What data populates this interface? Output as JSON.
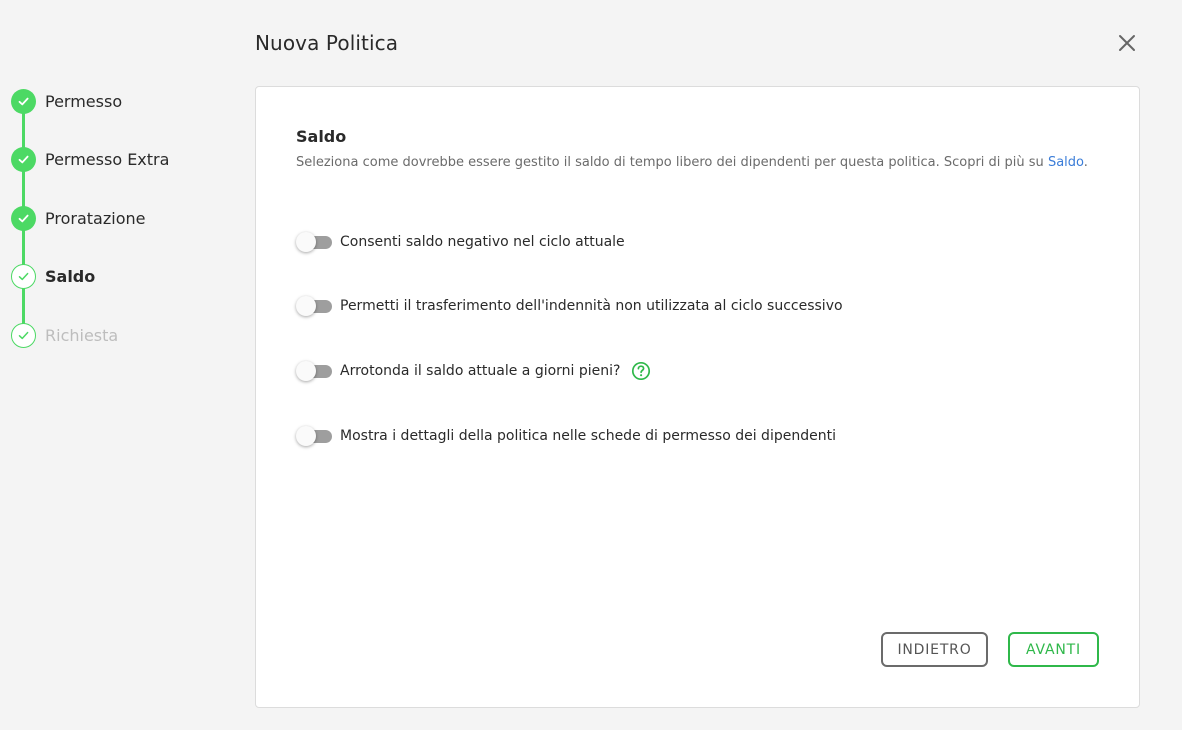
{
  "header": {
    "title": "Nuova Politica",
    "close_icon": "close-icon"
  },
  "stepper": {
    "steps": [
      {
        "label": "Permesso",
        "state": "done"
      },
      {
        "label": "Permesso Extra",
        "state": "done"
      },
      {
        "label": "Proratazione",
        "state": "done"
      },
      {
        "label": "Saldo",
        "state": "current"
      },
      {
        "label": "Richiesta",
        "state": "todo"
      }
    ],
    "accent_color": "#4cd964"
  },
  "section": {
    "title": "Saldo",
    "description": "Seleziona come dovrebbe essere gestito il saldo di tempo libero dei dipendenti per questa politica. Scopri di più su",
    "link_text": "Saldo",
    "link_suffix": "."
  },
  "options": [
    {
      "label": "Consenti saldo negativo nel ciclo attuale",
      "enabled": false
    },
    {
      "label": "Permetti il trasferimento dell'indennità non utilizzata al ciclo successivo",
      "enabled": false
    },
    {
      "label": "Arrotonda il saldo attuale a giorni pieni?",
      "enabled": false,
      "help_icon": "help-circle-icon"
    },
    {
      "label": "Mostra i dettagli della politica nelle schede di permesso dei dipendenti",
      "enabled": false
    }
  ],
  "footer": {
    "back_label": "INDIETRO",
    "next_label": "AVANTI",
    "next_color": "#2fb84a"
  }
}
